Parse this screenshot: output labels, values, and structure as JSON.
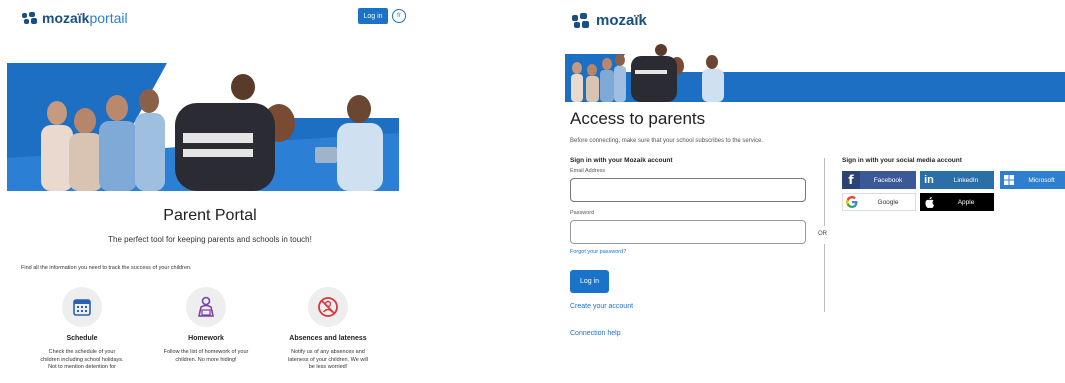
{
  "left": {
    "logo_bold": "mozaïk",
    "logo_thin": "portail",
    "login_button": "Log in",
    "lang_button": "fr",
    "title": "Parent Portal",
    "subtitle": "The perfect tool for keeping parents and schools in touch!",
    "intro": "Find all the information you need to track the success of your children.",
    "features": [
      {
        "icon": "calendar-icon",
        "title": "Schedule",
        "desc1": "Check the schedule of your",
        "desc2": "children including school holidays.",
        "desc3": "Not to mention detention for"
      },
      {
        "icon": "homework-icon",
        "title": "Homework",
        "desc1": "Follow the list of homework of your",
        "desc2": "children. No more hiding!",
        "desc3": ""
      },
      {
        "icon": "absence-icon",
        "title": "Absences and lateness",
        "desc1": "Notify us of any absences and",
        "desc2": "lateness of your children. We will",
        "desc3": "be less worried!"
      }
    ]
  },
  "right": {
    "logo": "mozaïk",
    "title": "Access to parents",
    "note": "Before connecting, make sure that your school subscribes to the service.",
    "mozaik_section": "Sign in with your Mozaik account",
    "email_label": "Email Address",
    "email_value": "",
    "password_label": "Password",
    "password_value": "",
    "forgot": "Forgot your password?",
    "login_button": "Log in",
    "create_account": "Create your account",
    "connection_help": "Connection help",
    "or": "OR",
    "social_section": "Sign in with your social media account",
    "social": {
      "facebook": "Facebook",
      "linkedin": "LinkedIn",
      "microsoft": "Microsoft",
      "google": "Google",
      "apple": "Apple"
    }
  },
  "colors": {
    "brand_dark": "#1a4f86",
    "brand_blue": "#1a73c8",
    "facebook": "#3b5998",
    "linkedin": "#2a6fa8",
    "microsoft": "#2f7fd1",
    "apple": "#000000"
  }
}
